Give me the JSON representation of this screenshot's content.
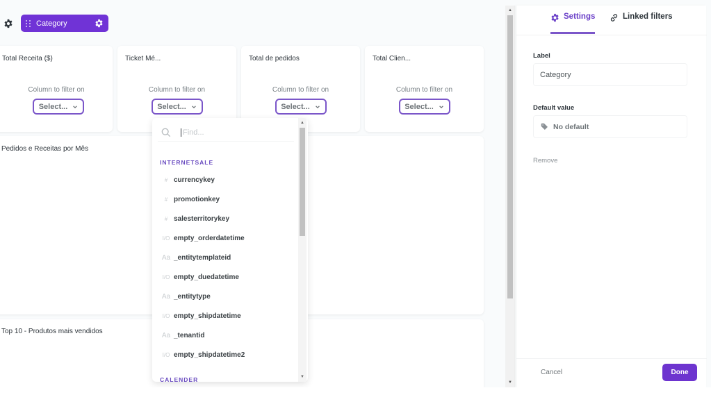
{
  "filter_bar": {
    "chip_label": "Category",
    "icons": {
      "gear": "gear-icon",
      "grip": "drag-handle-icon"
    }
  },
  "cards": [
    {
      "title": "Total Receita ($)",
      "column_label": "Column to filter on",
      "select_label": "Select..."
    },
    {
      "title": "Ticket Mé...",
      "column_label": "Column to filter on",
      "select_label": "Select..."
    },
    {
      "title": "Total de pedidos",
      "column_label": "Column to filter on",
      "select_label": "Select..."
    },
    {
      "title": "Total Clien...",
      "column_label": "Column to filter on",
      "select_label": "Select..."
    }
  ],
  "chart_cards": [
    {
      "title": "Pedidos e Receitas por Mês"
    },
    {
      "title": "Top 10 - Produtos mais vendidos"
    }
  ],
  "dropdown": {
    "search_placeholder": "Find...",
    "search_value": "",
    "sections": [
      {
        "name": "INTERNETSALE",
        "items": [
          {
            "icon": "#",
            "icon_name": "number-icon",
            "label": "currencykey"
          },
          {
            "icon": "#",
            "icon_name": "number-icon",
            "label": "promotionkey"
          },
          {
            "icon": "#",
            "icon_name": "number-icon",
            "label": "salesterritorykey"
          },
          {
            "icon": "I/O",
            "icon_name": "boolean-icon",
            "label": "empty_orderdatetime"
          },
          {
            "icon": "Aa",
            "icon_name": "text-icon",
            "label": "_entitytemplateid"
          },
          {
            "icon": "I/O",
            "icon_name": "boolean-icon",
            "label": "empty_duedatetime"
          },
          {
            "icon": "Aa",
            "icon_name": "text-icon",
            "label": "_entitytype"
          },
          {
            "icon": "I/O",
            "icon_name": "boolean-icon",
            "label": "empty_shipdatetime"
          },
          {
            "icon": "Aa",
            "icon_name": "text-icon",
            "label": "_tenantid"
          },
          {
            "icon": "I/O",
            "icon_name": "boolean-icon",
            "label": "empty_shipdatetime2"
          }
        ]
      },
      {
        "name": "CALENDER",
        "items": []
      }
    ]
  },
  "sidebar": {
    "tabs": [
      {
        "label": "Settings",
        "icon": "gear-icon",
        "active": true
      },
      {
        "label": "Linked filters",
        "icon": "link-icon",
        "active": false
      }
    ],
    "label_field": {
      "label": "Label",
      "value": "Category"
    },
    "default_field": {
      "label": "Default value",
      "placeholder": "No default",
      "icon": "tag-icon"
    },
    "remove_label": "Remove",
    "cancel_label": "Cancel",
    "done_label": "Done"
  },
  "colors": {
    "accent": "#7033d6",
    "accent_text": "#6a3fc8",
    "select_border": "#7b56c9",
    "background": "#f9fbfc"
  }
}
